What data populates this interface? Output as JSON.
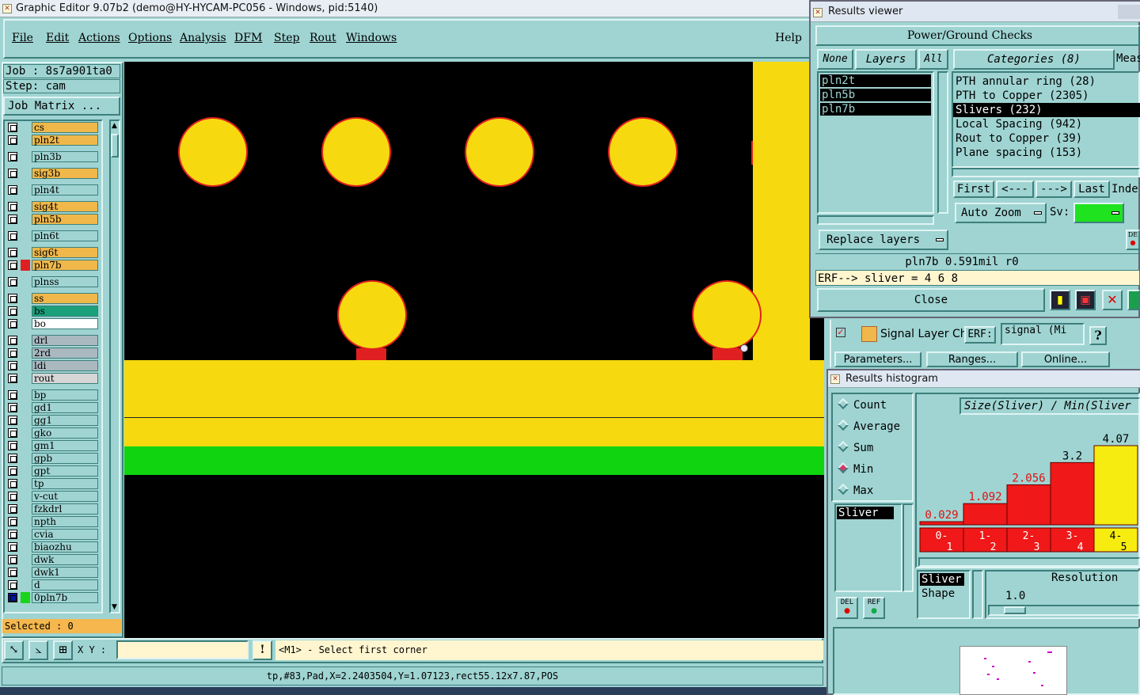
{
  "main_window": {
    "title": "Graphic Editor 9.07b2 (demo@HY-HYCAM-PC056 - Windows, pid:5140)",
    "menu": [
      "File",
      "Edit",
      "Actions",
      "Options",
      "Analysis",
      "DFM",
      "Step",
      "Rout",
      "Windows"
    ],
    "help": "Help"
  },
  "job": {
    "job_label": "Job : 8s7a901ta0",
    "step_label": "Step: cam",
    "matrix_button": "Job Matrix ..."
  },
  "layers": [
    {
      "name": "cs",
      "color": "#f0b84a"
    },
    {
      "name": "pln2t",
      "color": "#f0b84a"
    },
    {
      "name": "pln3b",
      "color": "#9fd4d2"
    },
    {
      "name": "sig3b",
      "color": "#f0b84a"
    },
    {
      "name": "pln4t",
      "color": "#9fd4d2"
    },
    {
      "name": "sig4t",
      "color": "#f0b84a"
    },
    {
      "name": "pln5b",
      "color": "#f0b84a"
    },
    {
      "name": "pln6t",
      "color": "#9fd4d2"
    },
    {
      "name": "sig6t",
      "color": "#f0b84a"
    },
    {
      "name": "pln7b",
      "color": "#f0b84a"
    },
    {
      "name": "plnss",
      "color": "#9fd4d2"
    },
    {
      "name": "ss",
      "color": "#f0b84a"
    },
    {
      "name": "bs",
      "color": "#1aa07a"
    },
    {
      "name": "bo",
      "color": "#ffffff"
    },
    {
      "name": "drl",
      "color": "#aab8c0"
    },
    {
      "name": "2rd",
      "color": "#aab8c0"
    },
    {
      "name": "ldi",
      "color": "#aab8c0"
    },
    {
      "name": "rout",
      "color": "#d6d6d6"
    },
    {
      "name": "bp",
      "color": "#9fd4d2"
    },
    {
      "name": "gd1",
      "color": "#9fd4d2"
    },
    {
      "name": "gg1",
      "color": "#9fd4d2"
    },
    {
      "name": "gko",
      "color": "#9fd4d2"
    },
    {
      "name": "gm1",
      "color": "#9fd4d2"
    },
    {
      "name": "gpb",
      "color": "#9fd4d2"
    },
    {
      "name": "gpt",
      "color": "#9fd4d2"
    },
    {
      "name": "tp",
      "color": "#9fd4d2"
    },
    {
      "name": "v-cut",
      "color": "#9fd4d2"
    },
    {
      "name": "fzkdrl",
      "color": "#9fd4d2"
    },
    {
      "name": "npth",
      "color": "#9fd4d2"
    },
    {
      "name": "cvia",
      "color": "#9fd4d2"
    },
    {
      "name": "biaozhu",
      "color": "#9fd4d2"
    },
    {
      "name": "dwk",
      "color": "#9fd4d2"
    },
    {
      "name": "dwk1",
      "color": "#9fd4d2"
    },
    {
      "name": "d",
      "color": "#9fd4d2"
    },
    {
      "name": "0pln7b",
      "color": "#9fd4d2"
    }
  ],
  "selected": "Selected : 0",
  "bottom": {
    "xy_label": "X Y :",
    "xy_value": "",
    "prompt": "<M1> - Select first corner",
    "status": "tp,#83,Pad,X=2.2403504,Y=1.07123,rect55.12x7.87,POS"
  },
  "results_viewer": {
    "title": "Results viewer",
    "heading": "Power/Ground Checks",
    "none_btn": "None",
    "layers_btn": "Layers",
    "all_btn": "All",
    "categories_btn": "Categories (8)",
    "meas": "Meas",
    "layer_list": [
      "pln2t",
      "pln5b",
      "pln7b"
    ],
    "categories": [
      "PTH annular ring (28)",
      "PTH to Copper (2305)",
      "Slivers (232)",
      "Local Spacing (942)",
      "Rout to Copper (39)",
      "Plane spacing (153)"
    ],
    "selected_category": "Slivers (232)",
    "nav": [
      "First",
      "<---",
      "--->",
      "Last",
      "Inde"
    ],
    "auto_zoom": "Auto Zoom",
    "sv_label": "Sv:",
    "replace": "Replace layers",
    "info": "pln7b 0.591mil  r0",
    "erf": "ERF--> sliver = 4 6 8",
    "close": "Close"
  },
  "signal_panel": {
    "title": "Signal Layer Ch",
    "erf_label": "ERF:",
    "erf_value": "signal (Mi",
    "help": "?",
    "params": "Parameters...",
    "ranges": "Ranges...",
    "online": "Online..."
  },
  "histogram": {
    "title": "Results histogram",
    "options": [
      "Count",
      "Average",
      "Sum",
      "Min",
      "Max"
    ],
    "selected_option": "Min",
    "list_item": "Sliver",
    "header": "Size(Sliver) / Min(Sliver",
    "del": "DEL",
    "ref": "REF",
    "shape_sel": "Sliver",
    "shape_label": "Shape",
    "resolution_label": "Resolution",
    "resolution_value": "1.0",
    "chart_data": {
      "type": "bar",
      "categories": [
        "0-1",
        "1-2",
        "2-3",
        "3-4",
        "4-5"
      ],
      "values": [
        0.029,
        1.092,
        2.056,
        3.2,
        4.07
      ],
      "value_labels": [
        "0.029",
        "1.092",
        "2.056",
        "3.2",
        "4.07"
      ],
      "colors": [
        "#f01818",
        "#f01818",
        "#f01818",
        "#f01818",
        "#f7ec10"
      ],
      "label_colors": [
        "#e01010",
        "#e01010",
        "#e01010",
        "#000000",
        "#000000"
      ]
    }
  }
}
